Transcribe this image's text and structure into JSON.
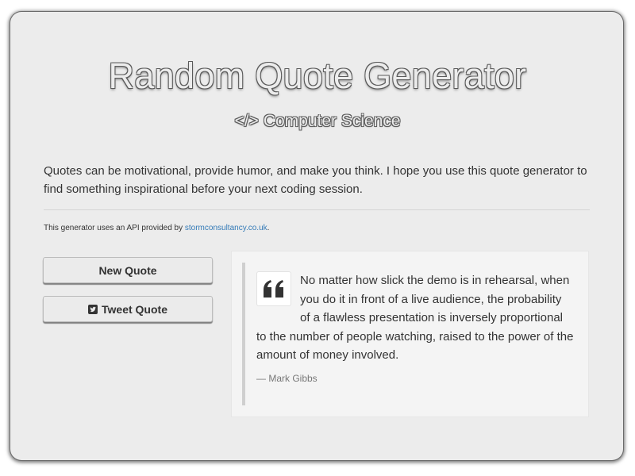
{
  "header": {
    "title": "Random Quote Generator",
    "subtitle": "Computer Science",
    "subtitle_icon": "code-icon"
  },
  "intro": {
    "text": "Quotes can be motivational, provide humor, and make you think. I hope you use this quote generator to find something inspirational before your next coding session."
  },
  "api_note": {
    "prefix": "This generator uses an API provided by ",
    "link_text": "stormconsultancy.co.uk",
    "suffix": "."
  },
  "buttons": {
    "new_quote": "New Quote",
    "tweet_quote": "Tweet Quote",
    "tweet_icon": "twitter-icon"
  },
  "quote": {
    "icon": "quote-left-icon",
    "text": "No matter how slick the demo is in rehearsal, when you do it in front of a live audience, the probability of a flawless presentation is inversely proportional to the number of people watching, raised to the power of the amount of money involved.",
    "author": "— Mark Gibbs"
  },
  "colors": {
    "panel_background": "#ececec",
    "link": "#337ab7",
    "text": "#333333",
    "author": "#777777"
  }
}
